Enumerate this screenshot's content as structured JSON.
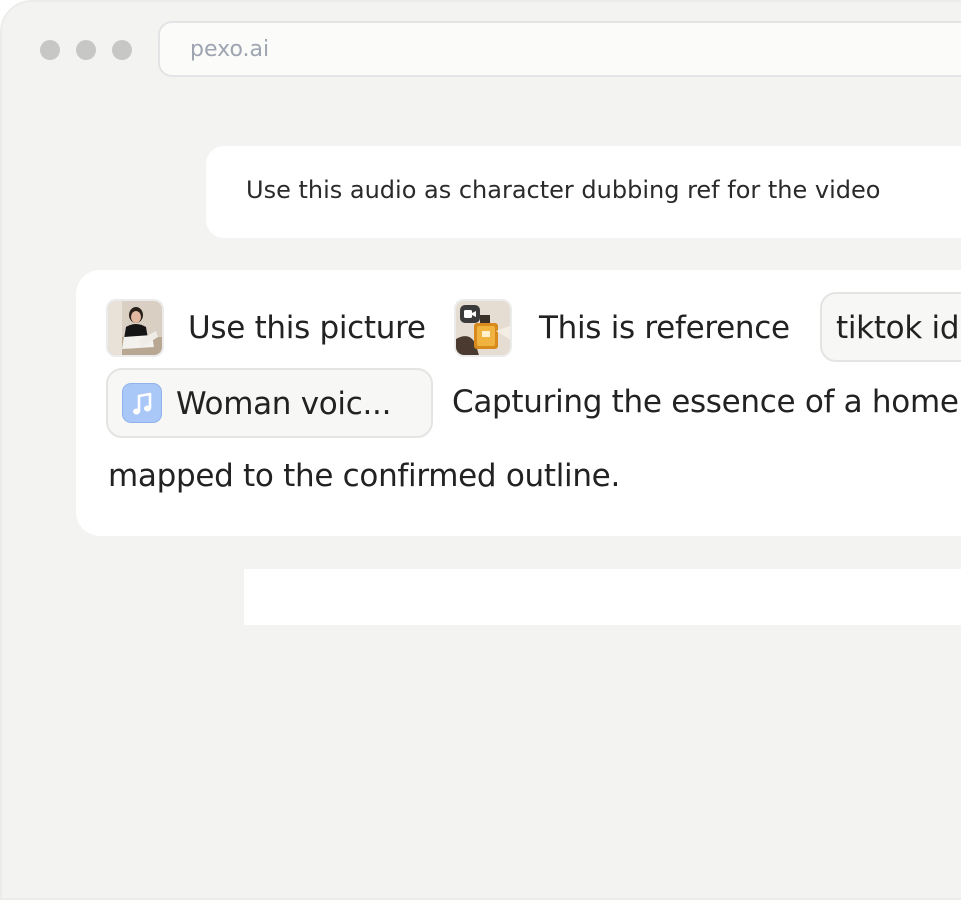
{
  "browser": {
    "url": "pexo.ai"
  },
  "chat": {
    "user_message": "Use this audio as character dubbing ref for the video",
    "composer": {
      "picture_label": "Use this picture",
      "reference_label": "This is reference",
      "chip_tiktok": "tiktok ide",
      "chip_voice": "Woman voic...",
      "line2_text": "Capturing the essence of a home",
      "line3_text": "mapped to the confirmed outline."
    }
  },
  "icons": {
    "window_controls": [
      "window-dot-icon",
      "window-dot-icon",
      "window-dot-icon"
    ],
    "photo_thumb": "woman-photo-thumbnail",
    "video_thumb": "perfume-video-thumbnail",
    "video_badge": "video-camera-icon",
    "audio_chip_icon": "music-note-icon"
  },
  "colors": {
    "window_bg": "#f3f3f1",
    "card_bg": "#ffffff",
    "music_icon_bg": "#a9c7f7",
    "url_text": "#9ea4b0"
  }
}
